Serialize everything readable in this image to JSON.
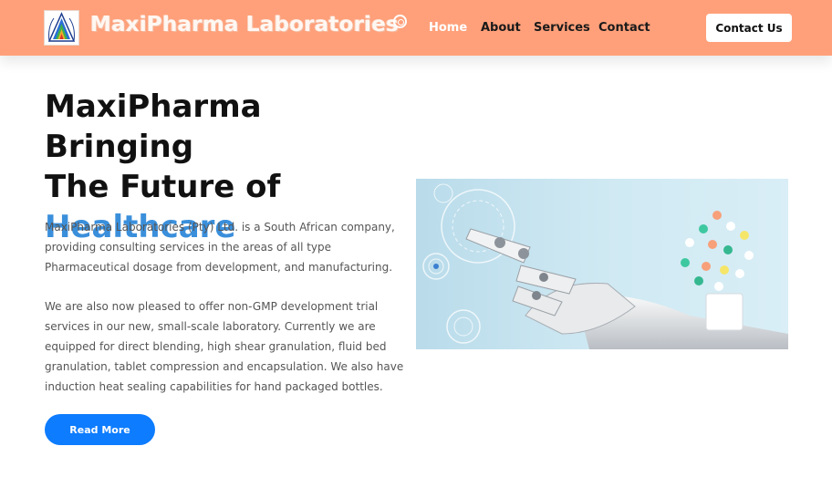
{
  "header": {
    "brand": "MaxiPharma Laboratories",
    "nav": [
      {
        "label": "Home",
        "active": true
      },
      {
        "label": "About",
        "active": false
      },
      {
        "label": "Services",
        "active": false
      },
      {
        "label": "Contact",
        "active": false
      }
    ],
    "cta_label": "Contact Us"
  },
  "hero": {
    "title_line1": "MaxiPharma Bringing",
    "title_line2": "The Future of",
    "title_accent": "Healthcare",
    "paragraph1": "MaxiPharma Laboratories (Pty) Ltd. is a South African company, providing consulting services in the areas of all type Pharmaceutical dosage from development, and manufacturing.",
    "paragraph2": "We are also now pleased to offer non-GMP development trial services in our new, small-scale laboratory. Currently we are equipped for direct blending, high shear granulation, fluid bed granulation, tablet compression and encapsulation. We also have induction heat sealing capabilities for hand packaged bottles.",
    "button_label": "Read More"
  },
  "colors": {
    "header_bg": "#ffa07a",
    "accent_text": "#3a8fdb",
    "button_bg": "#0d7cff"
  },
  "icons": {
    "logo": "triangle-logo-icon",
    "registered": "registered-mark-icon",
    "hero_image": "robot-hand-pills-image"
  }
}
